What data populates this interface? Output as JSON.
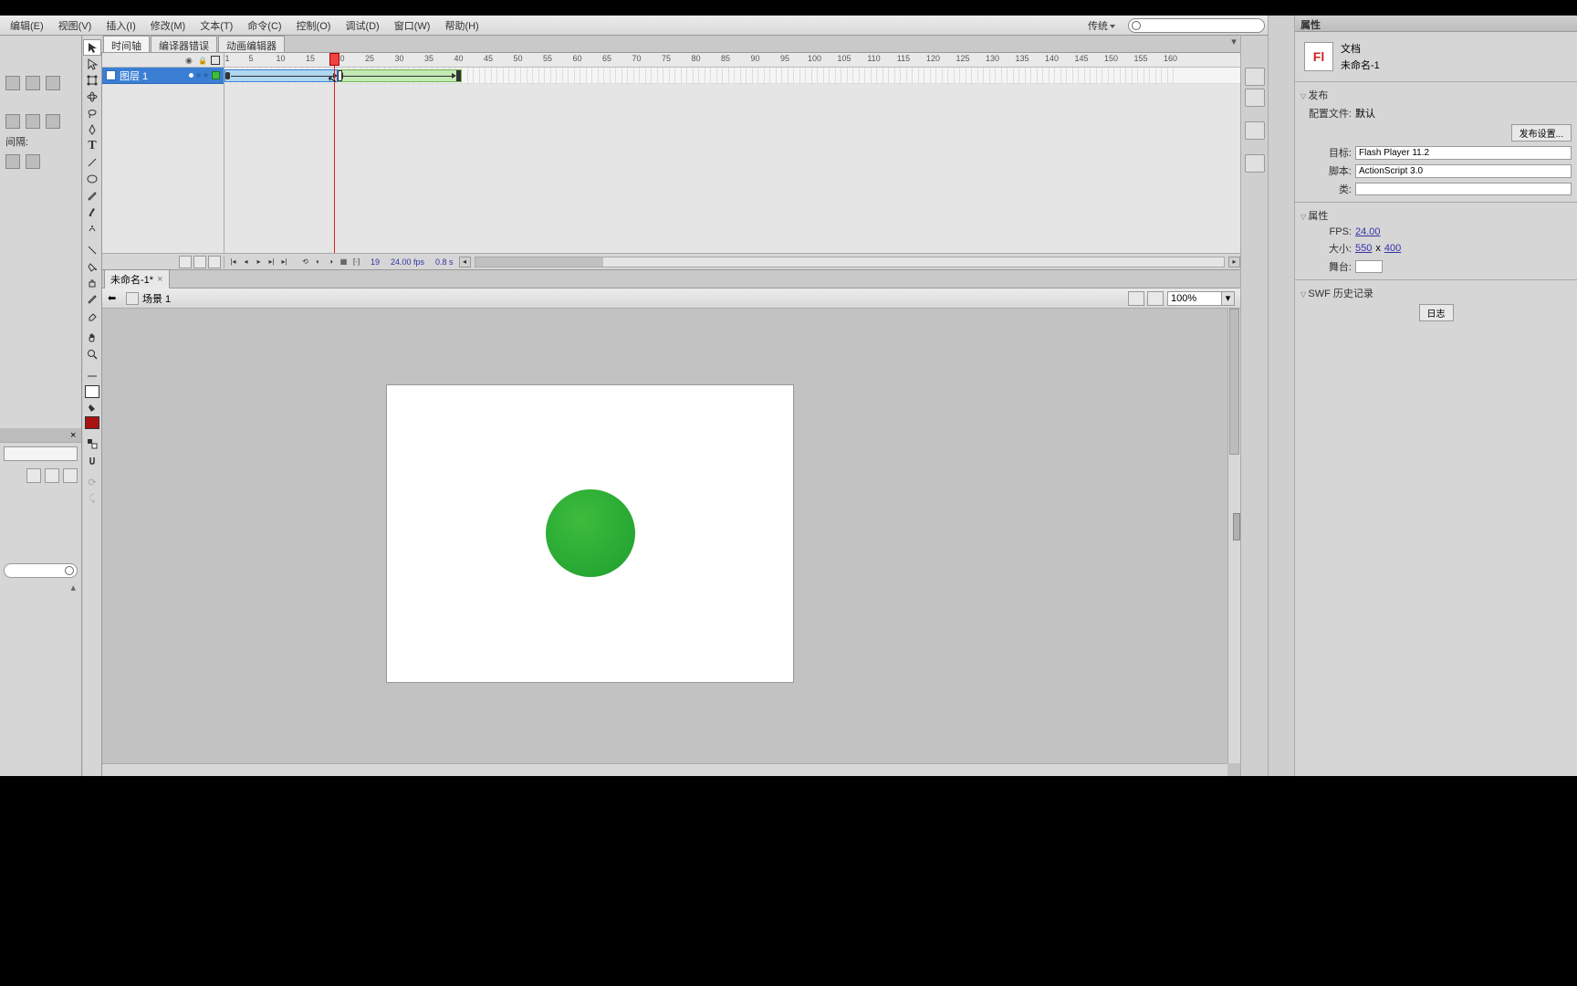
{
  "menu": {
    "items": [
      "编辑(E)",
      "视图(V)",
      "插入(I)",
      "修改(M)",
      "文本(T)",
      "命令(C)",
      "控制(O)",
      "调试(D)",
      "窗口(W)",
      "帮助(H)"
    ],
    "workspace": "传统"
  },
  "left_panel": {
    "gap_label": "间隔:"
  },
  "timeline_tabs": [
    "时间轴",
    "编译器错误",
    "动画编辑器"
  ],
  "timeline": {
    "layer_name": "图层 1",
    "ruler_start": 1,
    "ruler_step": 5,
    "ruler_end": 145,
    "playhead_frame": 19,
    "span1_start": 1,
    "span1_end": 20,
    "span2_start": 20,
    "span2_end": 40,
    "footer": {
      "frame": "19",
      "fps": "24.00 fps",
      "time": "0.8 s"
    }
  },
  "doc_tab": "未命名-1*",
  "scene": {
    "name": "场景 1",
    "zoom": "100%"
  },
  "stage": {
    "ball_color": "#2fab33"
  },
  "props": {
    "panel_title": "属性",
    "doc_label": "文档",
    "doc_name": "未命名-1",
    "publish_section": "发布",
    "profile_label": "配置文件:",
    "profile_value": "默认",
    "publish_settings_btn": "发布设置...",
    "target_label": "目标:",
    "target_value": "Flash Player 11.2",
    "script_label": "脚本:",
    "script_value": "ActionScript 3.0",
    "class_label": "类:",
    "class_value": "",
    "props_section": "属性",
    "fps_label": "FPS:",
    "fps_value": "24.00",
    "size_label": "大小:",
    "size_w": "550",
    "size_x": "x",
    "size_h": "400",
    "stage_label": "舞台:",
    "swf_section": "SWF 历史记录",
    "log_btn": "日志"
  }
}
